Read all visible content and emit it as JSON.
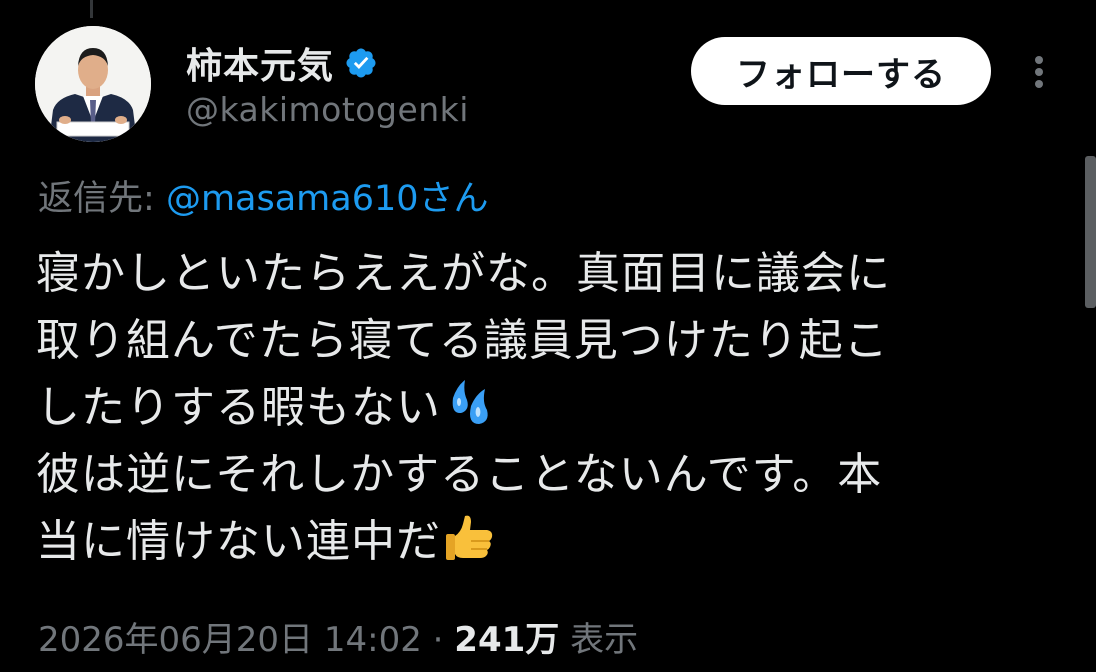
{
  "author": {
    "display_name": "柿本元気",
    "handle": "@kakimotogenki",
    "verified": true
  },
  "actions": {
    "follow_label": "フォローする",
    "more_icon": "more-vertical-icon"
  },
  "reply": {
    "prefix": "返信先:",
    "mention": "@masama610さん"
  },
  "tweet": {
    "lines": [
      "寝かしといたらええがな。真面目に議会に",
      "取り組んでたら寝てる議員見つけたり起こ",
      "したりする暇もない",
      "彼は逆にそれしかすることないんです。本",
      "当に情けない連中だ"
    ],
    "emojis": [
      "sweat-droplets-emoji",
      "thumbs-up-emoji"
    ]
  },
  "meta": {
    "timestamp": "2026年06月20日 14:02",
    "separator": "·",
    "views_count": "241万",
    "views_label": "表示"
  },
  "colors": {
    "background": "#000000",
    "text": "#e7e9ea",
    "muted": "#71767b",
    "link": "#1d9bf0",
    "verified": "#1d9bf0"
  }
}
